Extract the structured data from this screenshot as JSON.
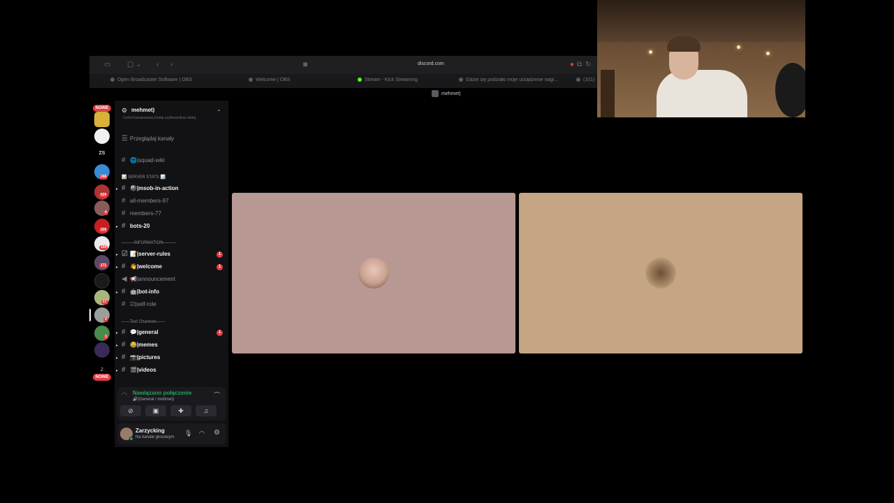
{
  "browser": {
    "url": "discord.com",
    "page_title": "mehmet)",
    "tabs": [
      "Open Broadcaster Software | OBS",
      "Welcome | OBS",
      "Stream - Kick Streaming",
      "Gdzie się podziało moje urządzenie nagr...",
      "(101)"
    ]
  },
  "rail": {
    "nowe_top": "NOWE",
    "nowe_bottom": "NOWE",
    "zs_label": "ZS",
    "badges": [
      "248",
      "529",
      "4",
      "225",
      "104",
      "171",
      "17",
      "3",
      "3"
    ],
    "last_letter": "Z"
  },
  "sidebar": {
    "server_name": "mehmet)",
    "header_overflow": "Cerbel kanałowania  Dodaj uzytkownikow dodaj",
    "browse_channels": "Przeglądaj kanały",
    "squad_wiki": "🌐|squad-wiki",
    "server_stats_category": "📊 SERVER STATS 📊",
    "channels_stats": [
      {
        "name": "🎱|msob-in-action",
        "state": "unread"
      },
      {
        "name": "all-members-97",
        "state": "read"
      },
      {
        "name": "members-77",
        "state": "read"
      },
      {
        "name": "bots-20",
        "state": "unread"
      }
    ],
    "information_category": "———INFORMATION———",
    "channels_info": [
      {
        "name": "📝|server-rules",
        "state": "unread",
        "mention": "1"
      },
      {
        "name": "👋|welcome",
        "state": "unread",
        "mention": "1"
      },
      {
        "name": "📢|announcement",
        "state": "read"
      },
      {
        "name": "🤖|bot-info",
        "state": "unread"
      },
      {
        "name": "☑|self-role",
        "state": "read"
      }
    ],
    "text_category": "——Text Channels——",
    "channels_text": [
      {
        "name": "💬|general",
        "state": "unread",
        "mention": "1"
      },
      {
        "name": "😂|memes",
        "state": "unread"
      },
      {
        "name": "📸|pictures",
        "state": "unread"
      },
      {
        "name": "🎬|videos",
        "state": "unread"
      }
    ],
    "voice": {
      "status": "Nawiązano połączenie",
      "location": "🔊|General / mehmet)"
    },
    "user": {
      "name": "Zarzycking",
      "status": "Na kanale głosowym"
    }
  },
  "colors": {
    "tile1_bg": "#b89893",
    "tile2_bg": "#c5a584",
    "connected_green": "#23a55a",
    "mention_red": "#e23d44"
  }
}
